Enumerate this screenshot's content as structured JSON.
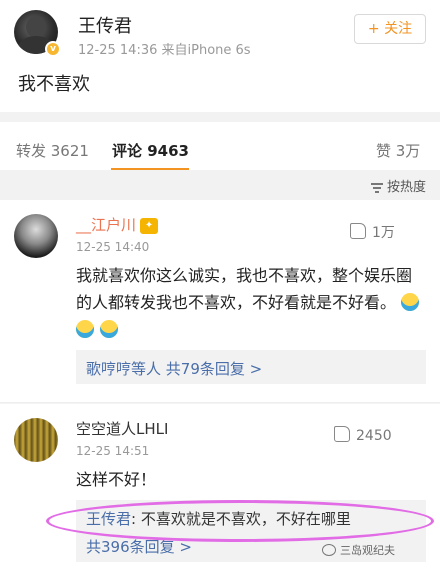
{
  "post": {
    "author": "王传君",
    "meta": "12-25 14:36  来自iPhone 6s",
    "follow_label": "+ 关注",
    "text": "我不喜欢"
  },
  "stats": {
    "repost": "转发 3621",
    "comment": "评论 9463",
    "like": "赞 3万"
  },
  "sort_label": "按热度",
  "comments": [
    {
      "name": "__江户川",
      "time": "12-25 14:40",
      "likes": "1万",
      "text": "我就喜欢你这么诚实，我也不喜欢，整个娱乐圈的人都转发我也不喜欢，不好看就是不好看。",
      "reply_prefix": "歌哼哼等人",
      "reply_count": "共79条回复 >"
    },
    {
      "name": "空空道人LHLI",
      "time": "12-25 14:51",
      "likes": "2450",
      "text": "这样不好！",
      "reply_author": "王传君",
      "reply_text": ": 不喜欢就是不喜欢，不好在哪里",
      "reply_count": "共396条回复 >"
    }
  ],
  "watermark": "三岛观纪夫",
  "colors": {
    "accent": "#f29322",
    "link": "#4a6ea9",
    "highlight": "#e16ce6"
  }
}
